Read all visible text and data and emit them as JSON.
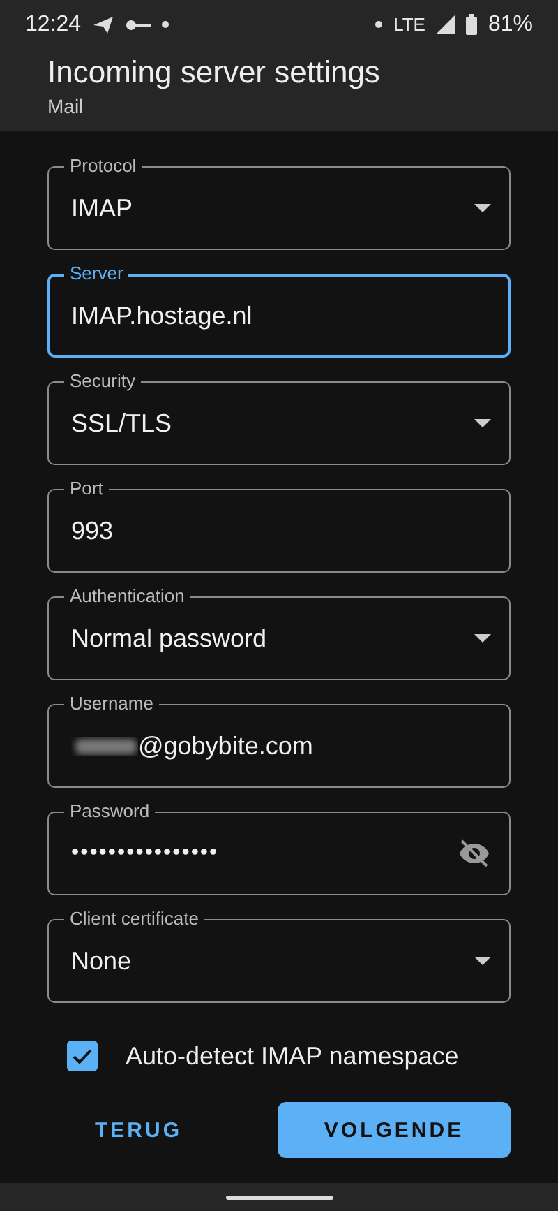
{
  "status_bar": {
    "time": "12:24",
    "network": "LTE",
    "battery": "81%"
  },
  "header": {
    "title": "Incoming server settings",
    "subtitle": "Mail"
  },
  "fields": [
    {
      "kind": "dropdown",
      "label": "Protocol",
      "value": "IMAP",
      "focused": false
    },
    {
      "kind": "text",
      "label": "Server",
      "value": "IMAP.hostage.nl",
      "focused": true
    },
    {
      "kind": "dropdown",
      "label": "Security",
      "value": "SSL/TLS",
      "focused": false
    },
    {
      "kind": "text",
      "label": "Port",
      "value": "993",
      "focused": false
    },
    {
      "kind": "dropdown",
      "label": "Authentication",
      "value": "Normal password",
      "focused": false
    },
    {
      "kind": "text",
      "label": "Username",
      "value": "@gobybite.com",
      "redacted": true,
      "focused": false
    },
    {
      "kind": "password",
      "label": "Password",
      "value": "••••••••••••••••",
      "focused": false
    },
    {
      "kind": "dropdown",
      "label": "Client certificate",
      "value": "None",
      "focused": false
    }
  ],
  "checkbox": {
    "label": "Auto-detect IMAP namespace",
    "checked": true
  },
  "buttons": [
    {
      "label": "TERUG",
      "kind": "text"
    },
    {
      "label": "VOLGENDE",
      "kind": "filled"
    }
  ]
}
